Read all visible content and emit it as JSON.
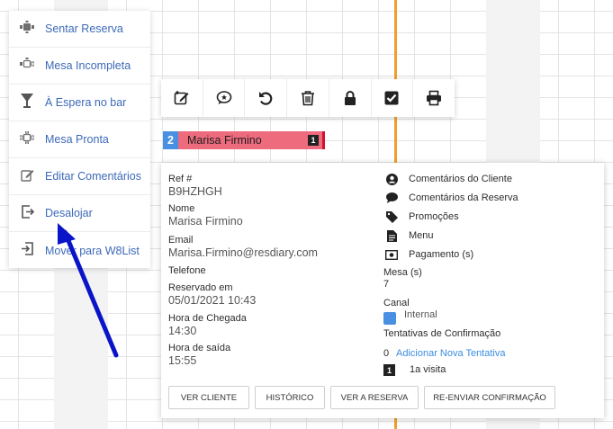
{
  "colors": {
    "link": "#3c69b8",
    "timeline": "#f0a02a",
    "booking": "#ee6b7e",
    "booking_border": "#d0142e",
    "covers": "#4a90e2",
    "arrow": "#0a14c8"
  },
  "context_menu": {
    "items": [
      {
        "icon": "seat-table-icon",
        "label": "Sentar Reserva"
      },
      {
        "icon": "incomplete-table-icon",
        "label": "Mesa Incompleta"
      },
      {
        "icon": "cocktail-glass-icon",
        "label": "À Espera no bar"
      },
      {
        "icon": "ready-table-icon",
        "label": "Mesa Pronta"
      },
      {
        "icon": "edit-icon",
        "label": "Editar Comentários"
      },
      {
        "icon": "unseat-icon",
        "label": "Desalojar"
      },
      {
        "icon": "move-waitlist-icon",
        "label": "Mover para W8List"
      }
    ]
  },
  "toolbar": {
    "buttons": [
      "edit-note-icon",
      "comment-icon",
      "undo-icon",
      "trash-icon",
      "lock-icon",
      "check-square-icon",
      "print-icon"
    ]
  },
  "booking": {
    "covers": "2",
    "name": "Marisa Firmino",
    "badge": "1"
  },
  "details": {
    "ref_label": "Ref #",
    "ref_value": "B9HZHGH",
    "name_label": "Nome",
    "name_value": "Marisa Firmino",
    "email_label": "Email",
    "email_value": "Marisa.Firmino@resdiary.com",
    "phone_label": "Telefone",
    "booked_label": "Reservado em",
    "booked_value": "05/01/2021 10:43",
    "arrival_label": "Hora de Chegada",
    "arrival_value": "14:30",
    "departure_label": "Hora de saída",
    "departure_value": "15:55"
  },
  "right_panel": {
    "client_comments": "Comentários do Cliente",
    "booking_comments": "Comentários da Reserva",
    "promotions": "Promoções",
    "menu": "Menu",
    "payment": "Pagamento (s)",
    "table_label": "Mesa (s)",
    "table_value": "7",
    "channel_label": "Canal",
    "channel_value": "Internal",
    "attempts_label": "Tentativas de Confirmação",
    "attempts_count": "0",
    "add_attempt": "Adicionar Nova Tentativa",
    "visit_badge": "1",
    "visit_text": "1a visita"
  },
  "buttons": {
    "view_client": "VER CLIENTE",
    "history": "HISTÓRICO",
    "view_booking": "VER A RESERVA",
    "resend": "RE-ENVIAR CONFIRMAÇÃO"
  }
}
